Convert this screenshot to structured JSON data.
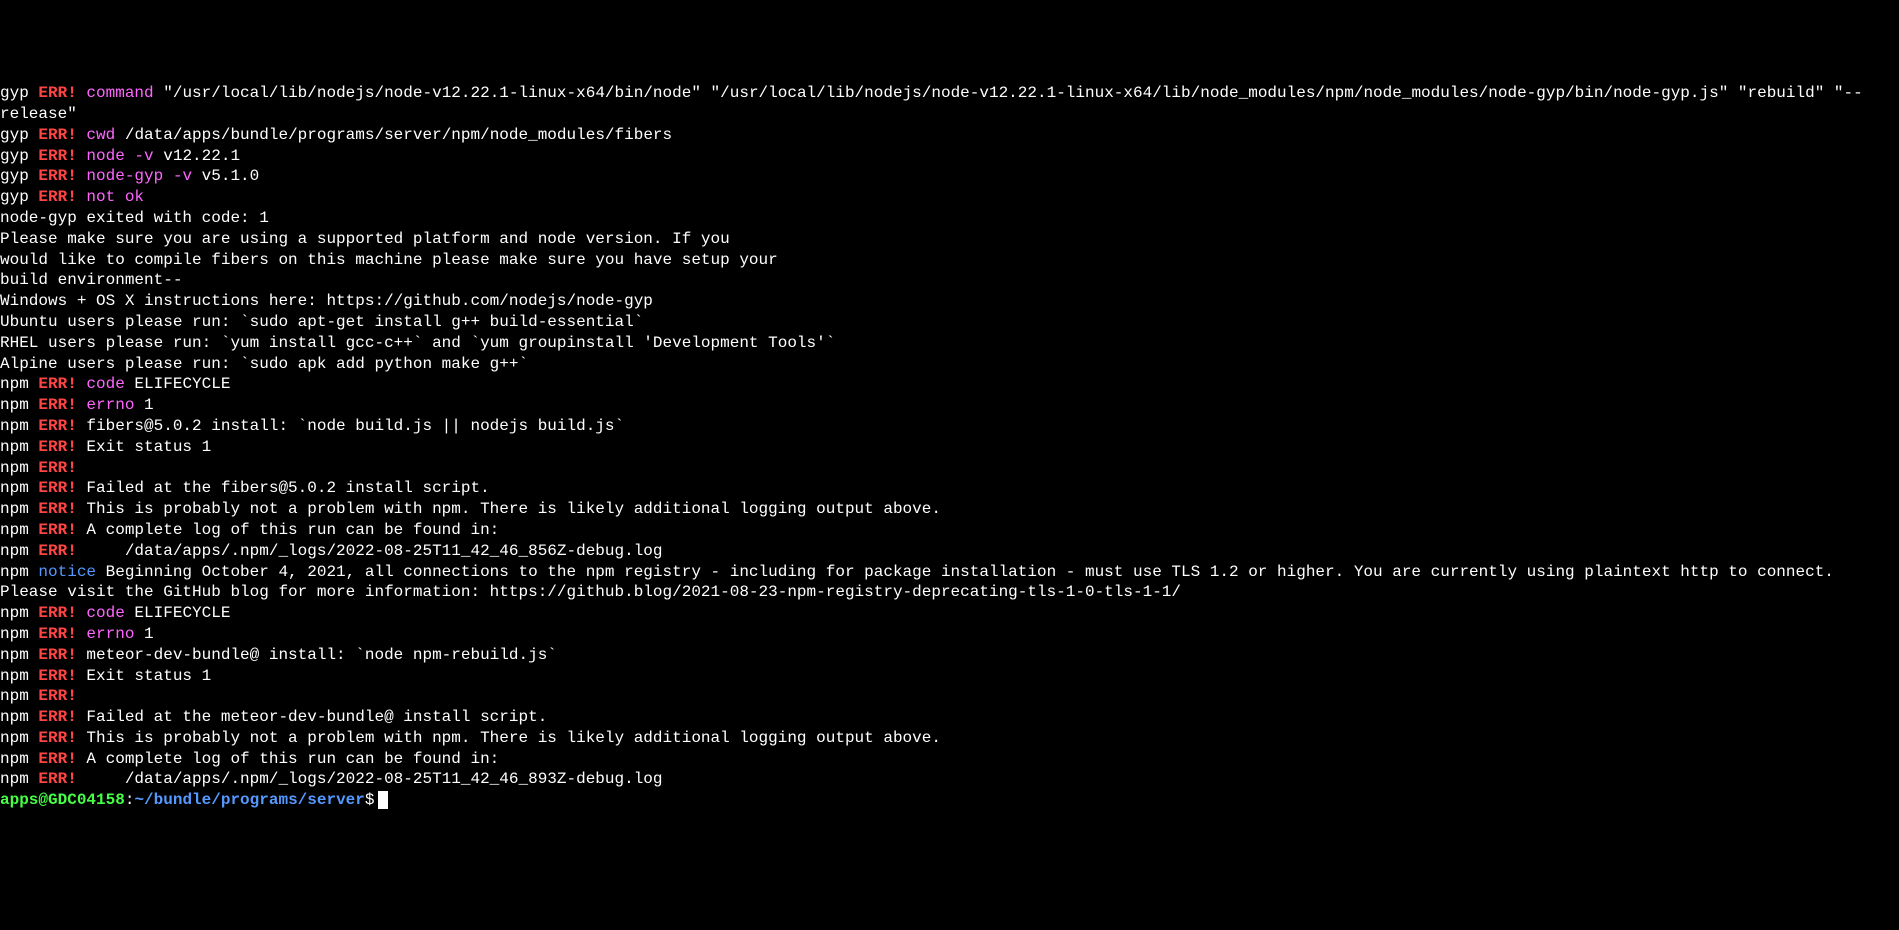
{
  "lines": [
    {
      "segments": [
        {
          "t": "gyp ",
          "c": "white"
        },
        {
          "t": "ERR!",
          "c": "err"
        },
        {
          "t": " ",
          "c": "white"
        },
        {
          "t": "command",
          "c": "magenta"
        },
        {
          "t": " \"/usr/local/lib/nodejs/node-v12.22.1-linux-x64/bin/node\" \"/usr/local/lib/nodejs/node-v12.22.1-linux-x64/lib/node_modules/npm/node_modules/node-gyp/bin/node-gyp.js\" \"rebuild\" \"--release\"",
          "c": "white"
        }
      ]
    },
    {
      "segments": [
        {
          "t": "gyp ",
          "c": "white"
        },
        {
          "t": "ERR!",
          "c": "err"
        },
        {
          "t": " ",
          "c": "white"
        },
        {
          "t": "cwd",
          "c": "magenta"
        },
        {
          "t": " /data/apps/bundle/programs/server/npm/node_modules/fibers",
          "c": "white"
        }
      ]
    },
    {
      "segments": [
        {
          "t": "gyp ",
          "c": "white"
        },
        {
          "t": "ERR!",
          "c": "err"
        },
        {
          "t": " ",
          "c": "white"
        },
        {
          "t": "node -v",
          "c": "magenta"
        },
        {
          "t": " v12.22.1",
          "c": "white"
        }
      ]
    },
    {
      "segments": [
        {
          "t": "gyp ",
          "c": "white"
        },
        {
          "t": "ERR!",
          "c": "err"
        },
        {
          "t": " ",
          "c": "white"
        },
        {
          "t": "node-gyp -v",
          "c": "magenta"
        },
        {
          "t": " v5.1.0",
          "c": "white"
        }
      ]
    },
    {
      "segments": [
        {
          "t": "gyp ",
          "c": "white"
        },
        {
          "t": "ERR!",
          "c": "err"
        },
        {
          "t": " ",
          "c": "white"
        },
        {
          "t": "not ok",
          "c": "magenta"
        }
      ]
    },
    {
      "segments": [
        {
          "t": "node-gyp exited with code: 1",
          "c": "white"
        }
      ]
    },
    {
      "segments": [
        {
          "t": "Please make sure you are using a supported platform and node version. If you",
          "c": "white"
        }
      ]
    },
    {
      "segments": [
        {
          "t": "would like to compile fibers on this machine please make sure you have setup your",
          "c": "white"
        }
      ]
    },
    {
      "segments": [
        {
          "t": "build environment--",
          "c": "white"
        }
      ]
    },
    {
      "segments": [
        {
          "t": "Windows + OS X instructions here: https://github.com/nodejs/node-gyp",
          "c": "white"
        }
      ]
    },
    {
      "segments": [
        {
          "t": "Ubuntu users please run: `sudo apt-get install g++ build-essential`",
          "c": "white"
        }
      ]
    },
    {
      "segments": [
        {
          "t": "RHEL users please run: `yum install gcc-c++` and `yum groupinstall 'Development Tools'`",
          "c": "white"
        }
      ]
    },
    {
      "segments": [
        {
          "t": "Alpine users please run: `sudo apk add python make g++`",
          "c": "white"
        }
      ]
    },
    {
      "segments": [
        {
          "t": "npm ",
          "c": "white"
        },
        {
          "t": "ERR!",
          "c": "err"
        },
        {
          "t": " ",
          "c": "white"
        },
        {
          "t": "code",
          "c": "magenta"
        },
        {
          "t": " ELIFECYCLE",
          "c": "white"
        }
      ]
    },
    {
      "segments": [
        {
          "t": "npm ",
          "c": "white"
        },
        {
          "t": "ERR!",
          "c": "err"
        },
        {
          "t": " ",
          "c": "white"
        },
        {
          "t": "errno",
          "c": "magenta"
        },
        {
          "t": " 1",
          "c": "white"
        }
      ]
    },
    {
      "segments": [
        {
          "t": "npm ",
          "c": "white"
        },
        {
          "t": "ERR!",
          "c": "err"
        },
        {
          "t": " fibers@5.0.2 install: `node build.js || nodejs build.js`",
          "c": "white"
        }
      ]
    },
    {
      "segments": [
        {
          "t": "npm ",
          "c": "white"
        },
        {
          "t": "ERR!",
          "c": "err"
        },
        {
          "t": " Exit status 1",
          "c": "white"
        }
      ]
    },
    {
      "segments": [
        {
          "t": "npm ",
          "c": "white"
        },
        {
          "t": "ERR!",
          "c": "err"
        }
      ]
    },
    {
      "segments": [
        {
          "t": "npm ",
          "c": "white"
        },
        {
          "t": "ERR!",
          "c": "err"
        },
        {
          "t": " Failed at the fibers@5.0.2 install script.",
          "c": "white"
        }
      ]
    },
    {
      "segments": [
        {
          "t": "npm ",
          "c": "white"
        },
        {
          "t": "ERR!",
          "c": "err"
        },
        {
          "t": " This is probably not a problem with npm. There is likely additional logging output above.",
          "c": "white"
        }
      ]
    },
    {
      "segments": [
        {
          "t": "",
          "c": "white"
        }
      ]
    },
    {
      "segments": [
        {
          "t": "npm ",
          "c": "white"
        },
        {
          "t": "ERR!",
          "c": "err"
        },
        {
          "t": " A complete log of this run can be found in:",
          "c": "white"
        }
      ]
    },
    {
      "segments": [
        {
          "t": "npm ",
          "c": "white"
        },
        {
          "t": "ERR!",
          "c": "err"
        },
        {
          "t": "     /data/apps/.npm/_logs/2022-08-25T11_42_46_856Z-debug.log",
          "c": "white"
        }
      ]
    },
    {
      "segments": [
        {
          "t": "npm ",
          "c": "white"
        },
        {
          "t": "notice",
          "c": "blue"
        },
        {
          "t": " Beginning October 4, 2021, all connections to the npm registry - including for package installation - must use TLS 1.2 or higher. You are currently using plaintext http to connect. Please visit the GitHub blog for more information: https://github.blog/2021-08-23-npm-registry-deprecating-tls-1-0-tls-1-1/",
          "c": "white"
        }
      ]
    },
    {
      "segments": [
        {
          "t": "npm ",
          "c": "white"
        },
        {
          "t": "ERR!",
          "c": "err"
        },
        {
          "t": " ",
          "c": "white"
        },
        {
          "t": "code",
          "c": "magenta"
        },
        {
          "t": " ELIFECYCLE",
          "c": "white"
        }
      ]
    },
    {
      "segments": [
        {
          "t": "npm ",
          "c": "white"
        },
        {
          "t": "ERR!",
          "c": "err"
        },
        {
          "t": " ",
          "c": "white"
        },
        {
          "t": "errno",
          "c": "magenta"
        },
        {
          "t": " 1",
          "c": "white"
        }
      ]
    },
    {
      "segments": [
        {
          "t": "npm ",
          "c": "white"
        },
        {
          "t": "ERR!",
          "c": "err"
        },
        {
          "t": " meteor-dev-bundle@ install: `node npm-rebuild.js`",
          "c": "white"
        }
      ]
    },
    {
      "segments": [
        {
          "t": "npm ",
          "c": "white"
        },
        {
          "t": "ERR!",
          "c": "err"
        },
        {
          "t": " Exit status 1",
          "c": "white"
        }
      ]
    },
    {
      "segments": [
        {
          "t": "npm ",
          "c": "white"
        },
        {
          "t": "ERR!",
          "c": "err"
        }
      ]
    },
    {
      "segments": [
        {
          "t": "npm ",
          "c": "white"
        },
        {
          "t": "ERR!",
          "c": "err"
        },
        {
          "t": " Failed at the meteor-dev-bundle@ install script.",
          "c": "white"
        }
      ]
    },
    {
      "segments": [
        {
          "t": "npm ",
          "c": "white"
        },
        {
          "t": "ERR!",
          "c": "err"
        },
        {
          "t": " This is probably not a problem with npm. There is likely additional logging output above.",
          "c": "white"
        }
      ]
    },
    {
      "segments": [
        {
          "t": "",
          "c": "white"
        }
      ]
    },
    {
      "segments": [
        {
          "t": "npm ",
          "c": "white"
        },
        {
          "t": "ERR!",
          "c": "err"
        },
        {
          "t": " A complete log of this run can be found in:",
          "c": "white"
        }
      ]
    },
    {
      "segments": [
        {
          "t": "npm ",
          "c": "white"
        },
        {
          "t": "ERR!",
          "c": "err"
        },
        {
          "t": "     /data/apps/.npm/_logs/2022-08-25T11_42_46_893Z-debug.log",
          "c": "white"
        }
      ]
    }
  ],
  "prompt": {
    "user_host": "apps@GDC04158",
    "separator": ":",
    "path": "~/bundle/programs/server",
    "symbol": "$"
  }
}
